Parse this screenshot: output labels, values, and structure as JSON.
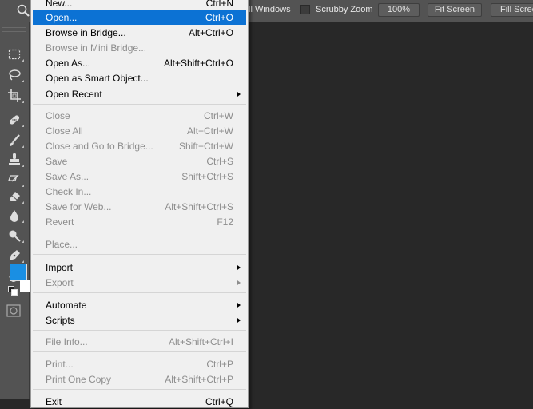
{
  "options_bar": {
    "partial_label": "ll Windows",
    "scrubby_zoom": "Scrubby Zoom",
    "zoom_100": "100%",
    "fit_screen": "Fit Screen",
    "fill_screen": "Fill Scree"
  },
  "menu": {
    "new": {
      "label": "New...",
      "shortcut": "Ctrl+N"
    },
    "open": {
      "label": "Open...",
      "shortcut": "Ctrl+O"
    },
    "browse_bridge": {
      "label": "Browse in Bridge...",
      "shortcut": "Alt+Ctrl+O"
    },
    "browse_mini_bridge": {
      "label": "Browse in Mini Bridge..."
    },
    "open_as": {
      "label": "Open As...",
      "shortcut": "Alt+Shift+Ctrl+O"
    },
    "open_smart_object": {
      "label": "Open as Smart Object..."
    },
    "open_recent": {
      "label": "Open Recent"
    },
    "close": {
      "label": "Close",
      "shortcut": "Ctrl+W"
    },
    "close_all": {
      "label": "Close All",
      "shortcut": "Alt+Ctrl+W"
    },
    "close_go_bridge": {
      "label": "Close and Go to Bridge...",
      "shortcut": "Shift+Ctrl+W"
    },
    "save": {
      "label": "Save",
      "shortcut": "Ctrl+S"
    },
    "save_as": {
      "label": "Save As...",
      "shortcut": "Shift+Ctrl+S"
    },
    "check_in": {
      "label": "Check In..."
    },
    "save_for_web": {
      "label": "Save for Web...",
      "shortcut": "Alt+Shift+Ctrl+S"
    },
    "revert": {
      "label": "Revert",
      "shortcut": "F12"
    },
    "place": {
      "label": "Place..."
    },
    "import": {
      "label": "Import"
    },
    "export": {
      "label": "Export"
    },
    "automate": {
      "label": "Automate"
    },
    "scripts": {
      "label": "Scripts"
    },
    "file_info": {
      "label": "File Info...",
      "shortcut": "Alt+Shift+Ctrl+I"
    },
    "print": {
      "label": "Print...",
      "shortcut": "Ctrl+P"
    },
    "print_one_copy": {
      "label": "Print One Copy",
      "shortcut": "Alt+Shift+Ctrl+P"
    },
    "exit": {
      "label": "Exit",
      "shortcut": "Ctrl+Q"
    }
  },
  "colors": {
    "foreground": "#1a8fe3",
    "background": "#ffffff",
    "highlight": "#0c72d4"
  }
}
